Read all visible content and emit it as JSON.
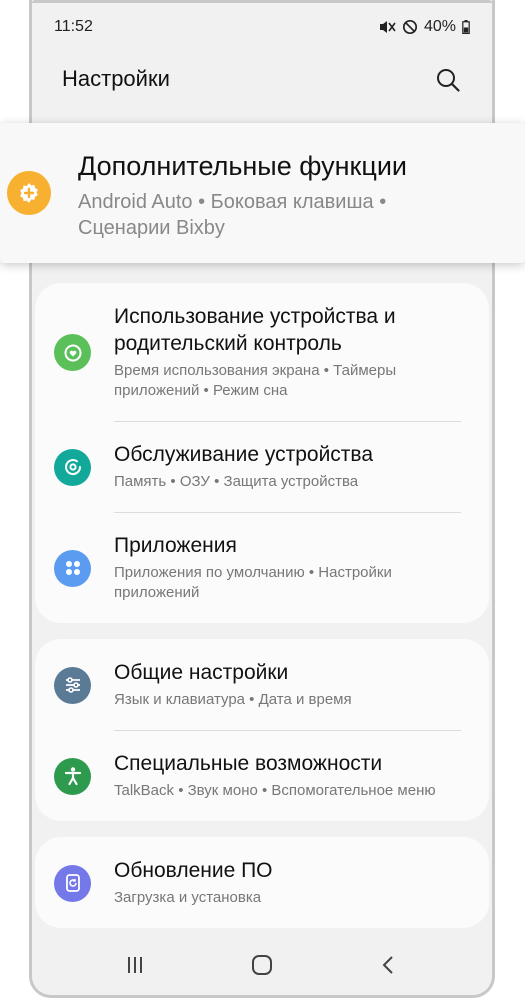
{
  "status": {
    "time": "11:52",
    "battery": "40%"
  },
  "header": {
    "title": "Настройки"
  },
  "highlight": {
    "title": "Дополнительные функции",
    "subtitle": "Android Auto  •  Боковая клавиша  •  Сценарии Bixby",
    "icon_color": "#f7b030"
  },
  "cards": [
    {
      "items": [
        {
          "title": "Использование устройства и родительский контроль",
          "subtitle": "Время использования экрана  •  Таймеры приложений  •  Режим сна",
          "icon": "wellbeing-icon",
          "icon_color": "#5cc05a"
        },
        {
          "title": "Обслуживание устройства",
          "subtitle": "Память  •  ОЗУ  •  Защита устройства",
          "icon": "device-care-icon",
          "icon_color": "#12a89a"
        },
        {
          "title": "Приложения",
          "subtitle": "Приложения по умолчанию  •  Настройки приложений",
          "icon": "apps-icon",
          "icon_color": "#5b9cf0"
        }
      ]
    },
    {
      "items": [
        {
          "title": "Общие настройки",
          "subtitle": "Язык и клавиатура  •  Дата и время",
          "icon": "sliders-icon",
          "icon_color": "#5a7a96"
        },
        {
          "title": "Специальные возможности",
          "subtitle": "TalkBack  •  Звук моно  •  Вспомогательное меню",
          "icon": "accessibility-icon",
          "icon_color": "#2e9a4e"
        }
      ]
    },
    {
      "items": [
        {
          "title": "Обновление ПО",
          "subtitle": "Загрузка и установка",
          "icon": "update-icon",
          "icon_color": "#7478e8"
        }
      ]
    }
  ]
}
